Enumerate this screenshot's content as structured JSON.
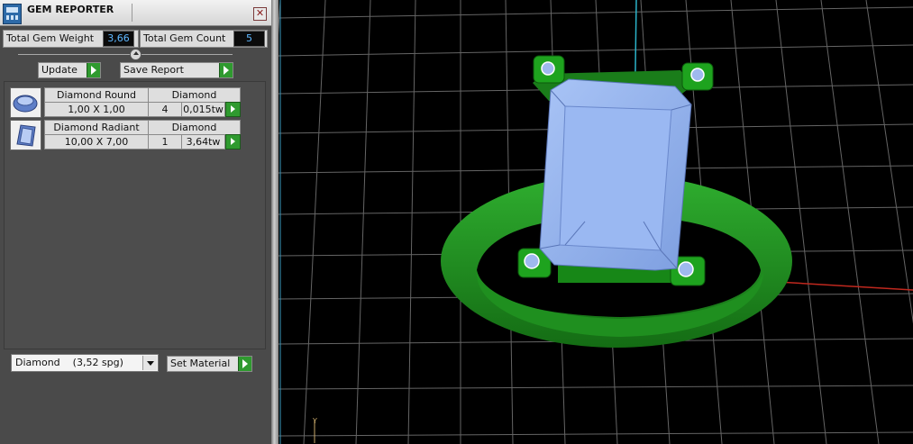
{
  "window": {
    "title": "GEM REPORTER",
    "close_glyph": "✕",
    "icon": "app-icon"
  },
  "stats": {
    "total_weight_label": "Total Gem Weight",
    "total_weight_value": "3,66",
    "total_count_label": "Total Gem Count",
    "total_count_value": "5"
  },
  "toolbar": {
    "update_label": "Update",
    "save_report_label": "Save Report"
  },
  "gems": [
    {
      "icon": "round-gem-icon",
      "shape": "Diamond Round",
      "type": "Diamond",
      "size": "1,00 X 1,00",
      "count": "4",
      "weight": "0,015tw"
    },
    {
      "icon": "radiant-gem-icon",
      "shape": "Diamond Radiant",
      "type": "Diamond",
      "size": "10,00 X 7,00",
      "count": "1",
      "weight": "3,64tw"
    }
  ],
  "material": {
    "selected": "Diamond    (3,52 spg)",
    "set_label": "Set Material"
  },
  "colors": {
    "gem_blue": "#8fb2ee",
    "ring_green": "#1f8f1f",
    "grid": "#7a7a7a",
    "accent_green": "#2f9a2f"
  }
}
